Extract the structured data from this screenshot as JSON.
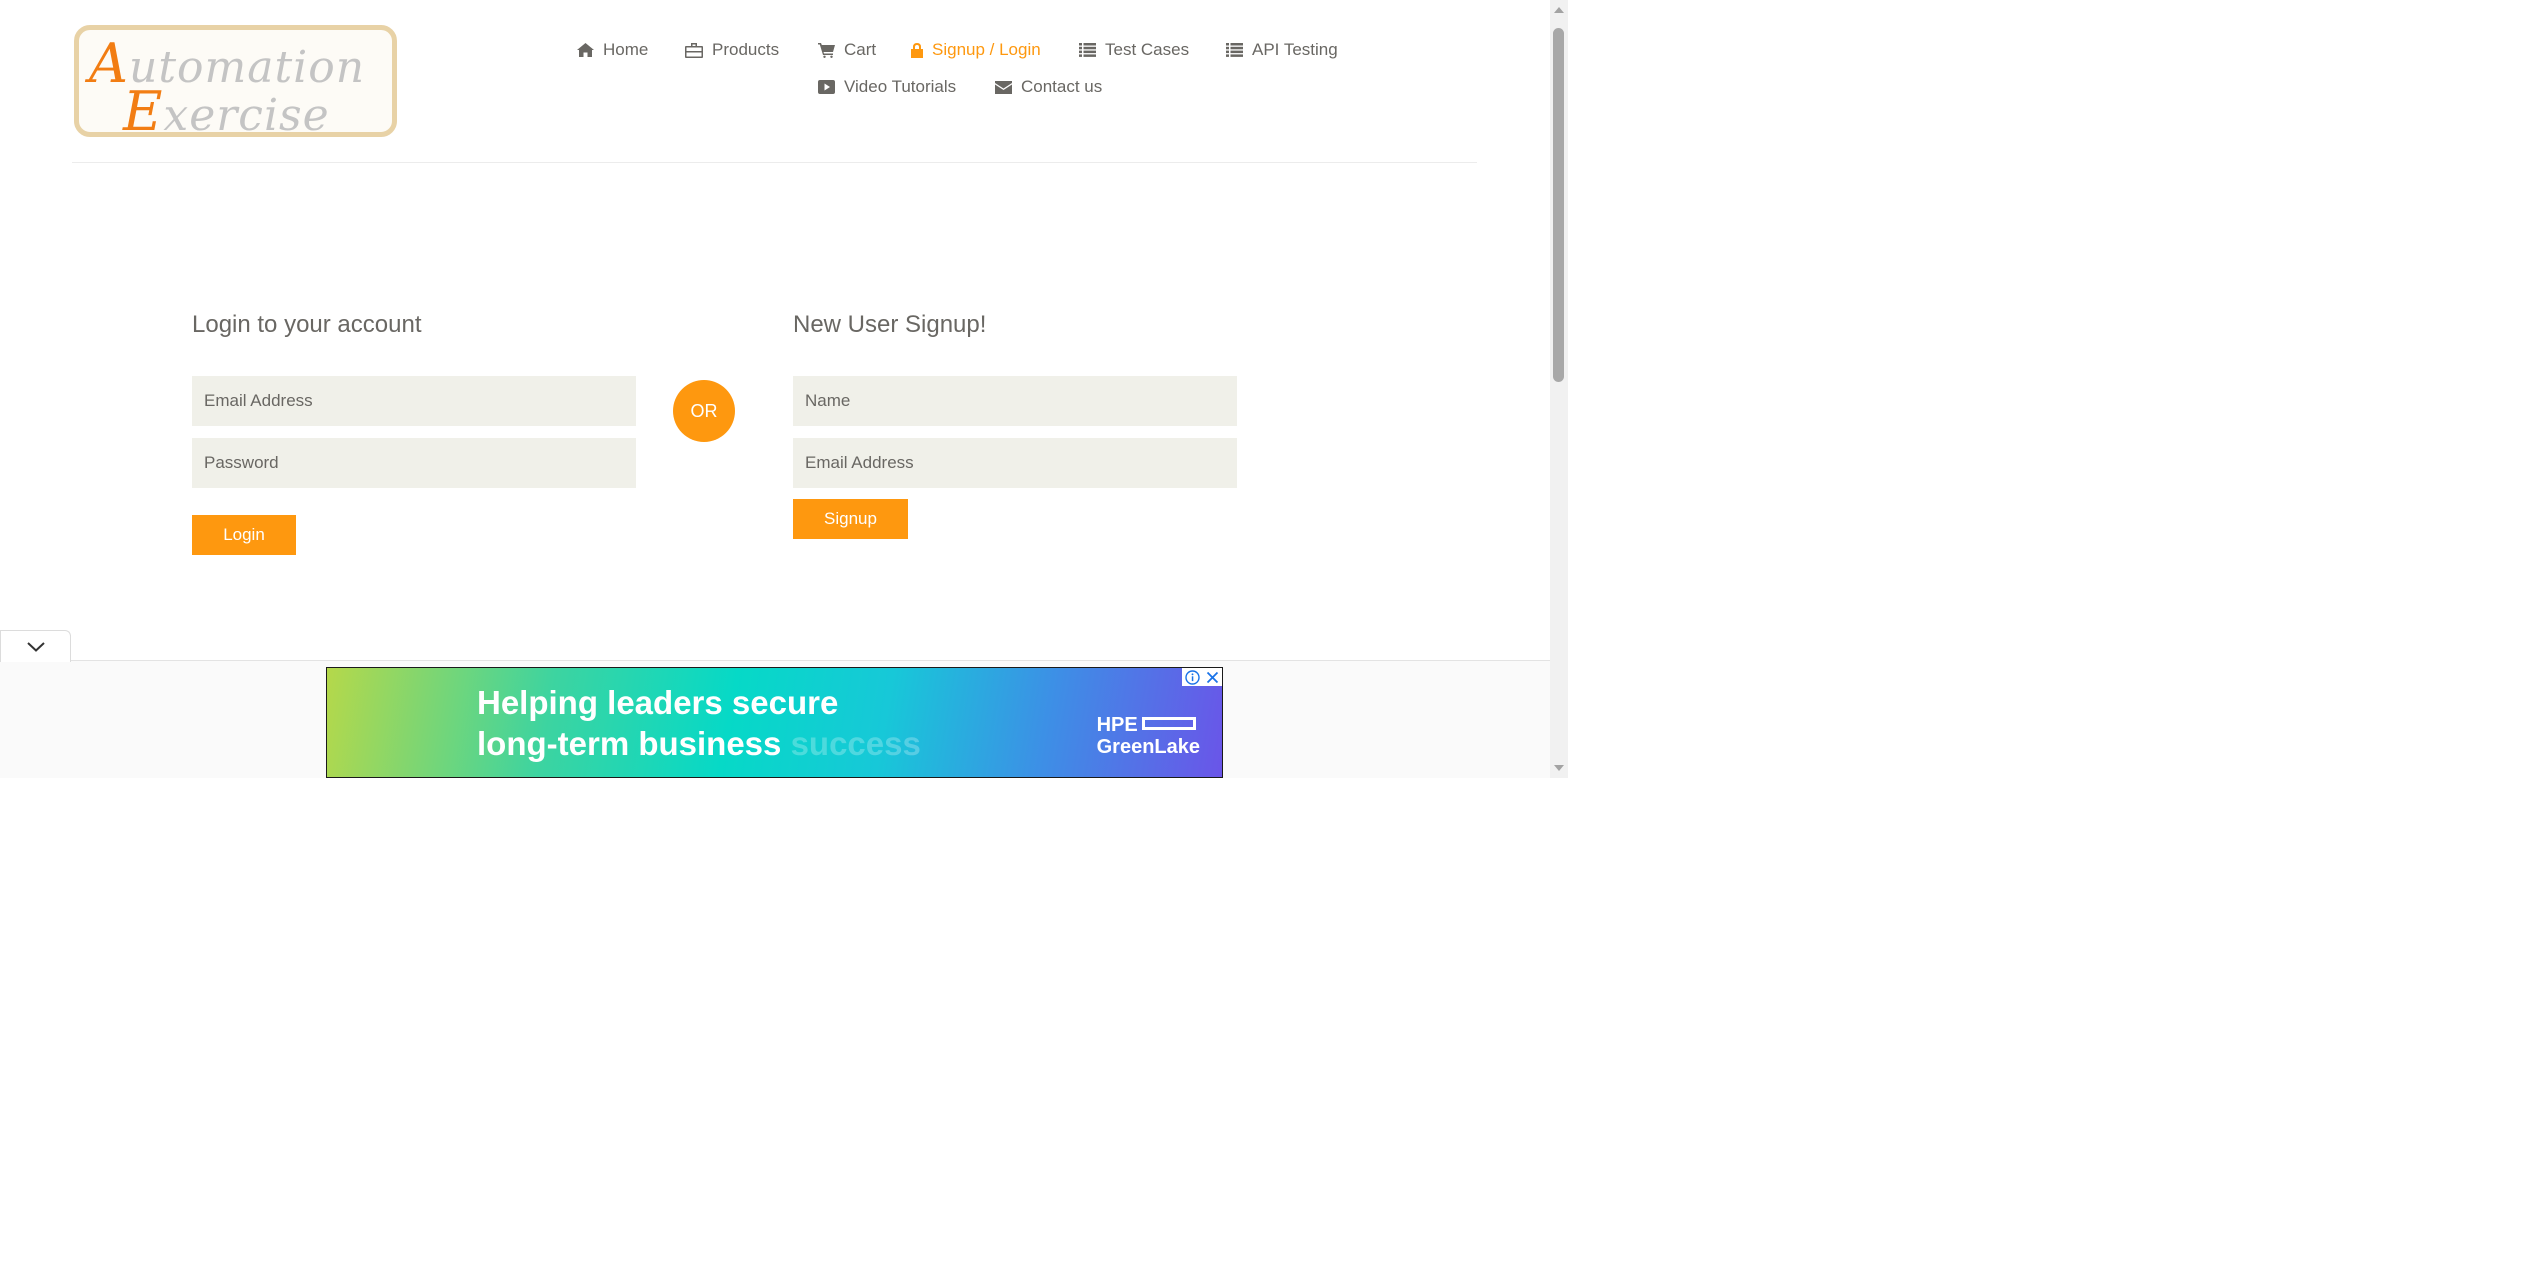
{
  "logo": {
    "line1": "Automation",
    "line2": "Exercise"
  },
  "nav": {
    "items": [
      {
        "label": "Home",
        "icon": "home-icon"
      },
      {
        "label": "Products",
        "icon": "briefcase-icon"
      },
      {
        "label": "Cart",
        "icon": "cart-icon"
      },
      {
        "label": "Signup / Login",
        "icon": "lock-icon",
        "active": true
      },
      {
        "label": "Test Cases",
        "icon": "list-icon"
      },
      {
        "label": "API Testing",
        "icon": "list-icon"
      },
      {
        "label": "Video Tutorials",
        "icon": "youtube-play-icon"
      },
      {
        "label": "Contact us",
        "icon": "envelope-icon"
      }
    ]
  },
  "login": {
    "title": "Login to your account",
    "email_placeholder": "Email Address",
    "password_placeholder": "Password",
    "button": "Login"
  },
  "divider": {
    "label": "OR"
  },
  "signup": {
    "title": "New User Signup!",
    "name_placeholder": "Name",
    "email_placeholder": "Email Address",
    "button": "Signup"
  },
  "ad": {
    "headline_line1": "Helping leaders secure",
    "headline_line2": "long-term business",
    "headline_line2_faded": "success",
    "brand_line1": "HPE",
    "brand_line2": "GreenLake"
  },
  "colors": {
    "accent": "#fe980f",
    "text": "#696763",
    "field_bg": "#f0f0e9"
  }
}
